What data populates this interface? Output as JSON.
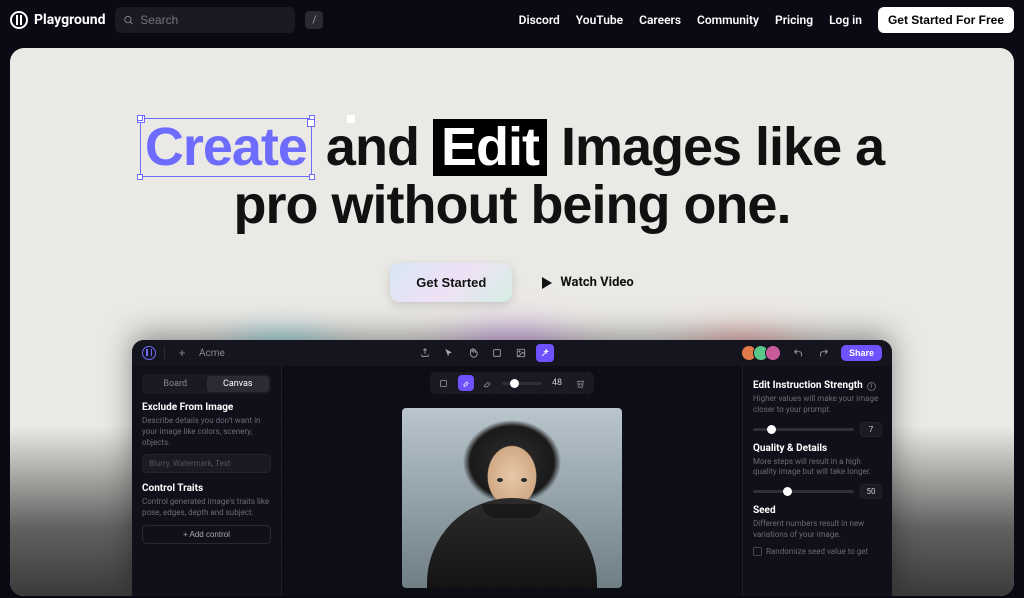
{
  "nav": {
    "brand": "Playground",
    "search_placeholder": "Search",
    "kbd": "/",
    "links": [
      "Discord",
      "YouTube",
      "Careers",
      "Community",
      "Pricing",
      "Log in"
    ],
    "cta": "Get Started For Free"
  },
  "hero": {
    "word_create": "Create",
    "word_and": " and ",
    "word_edit": "Edit",
    "rest_line1": " Images like a",
    "line2": "pro without being one.",
    "get_started": "Get Started",
    "watch_video": "Watch Video"
  },
  "app": {
    "breadcrumb": "Acme",
    "share": "Share",
    "tabs": {
      "board": "Board",
      "canvas": "Canvas"
    },
    "left": {
      "exclude_title": "Exclude From Image",
      "exclude_desc": "Describe details you don't want in your image like colors, scenery, objects.",
      "exclude_placeholder": "Blurry, Watermark, Text",
      "control_title": "Control Traits",
      "control_desc": "Control generated image's traits like pose, edges, depth and subject.",
      "add_control": "+  Add control"
    },
    "canvas_toolbar": {
      "value": "48"
    },
    "right": {
      "strength_title": "Edit Instruction Strength",
      "strength_desc": "Higher values will make your image closer to your prompt.",
      "strength_value": "7",
      "quality_title": "Quality & Details",
      "quality_desc": "More steps will result in a high quality image but will take longer.",
      "quality_value": "50",
      "seed_title": "Seed",
      "seed_desc": "Different numbers result in new variations of your image.",
      "randomize": "Randomize seed value to get"
    }
  }
}
